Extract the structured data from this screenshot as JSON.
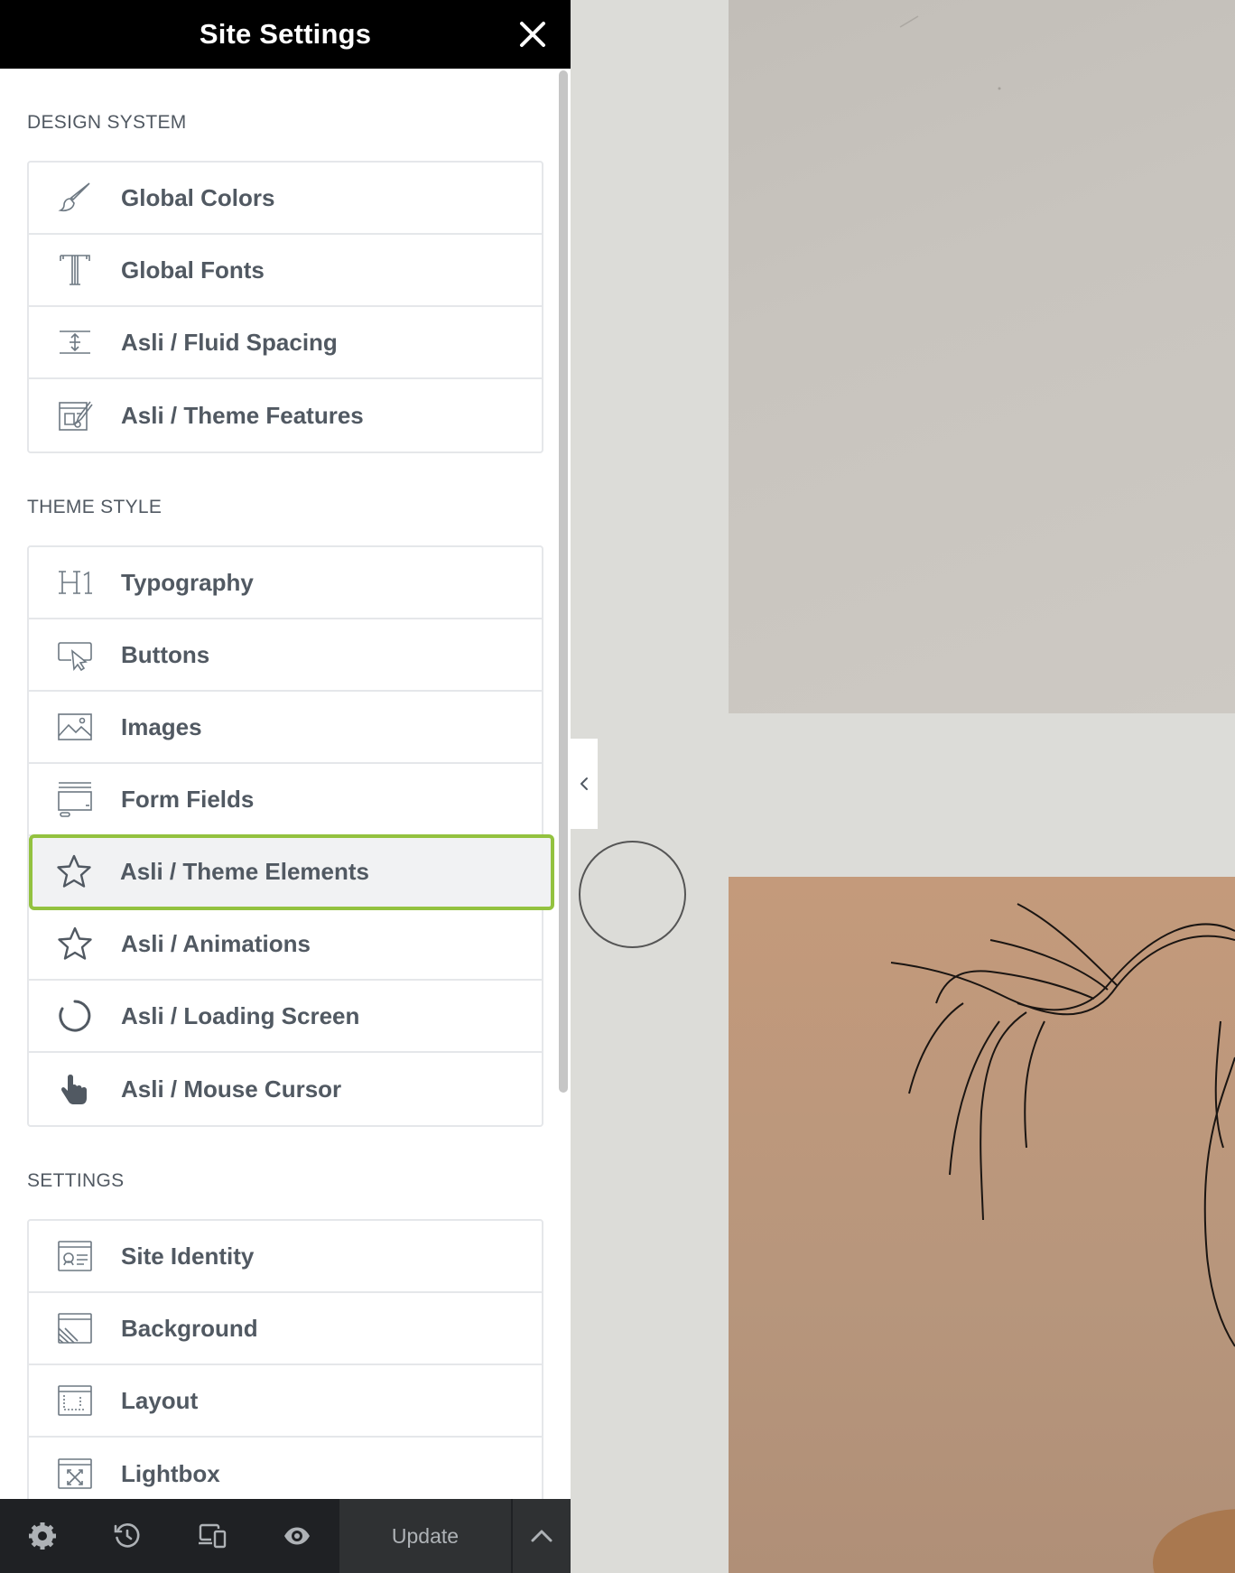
{
  "header": {
    "title": "Site Settings"
  },
  "sections": {
    "design_system": {
      "title": "DESIGN SYSTEM",
      "items": [
        {
          "label": "Global Colors",
          "icon": "paintbrush-icon"
        },
        {
          "label": "Global Fonts",
          "icon": "typeface-icon"
        },
        {
          "label": "Asli / Fluid Spacing",
          "icon": "spacing-icon"
        },
        {
          "label": "Asli / Theme Features",
          "icon": "theme-features-icon"
        }
      ]
    },
    "theme_style": {
      "title": "THEME STYLE",
      "items": [
        {
          "label": "Typography",
          "icon": "h1-icon"
        },
        {
          "label": "Buttons",
          "icon": "button-cursor-icon"
        },
        {
          "label": "Images",
          "icon": "image-icon"
        },
        {
          "label": "Form Fields",
          "icon": "form-fields-icon"
        },
        {
          "label": "Asli / Theme Elements",
          "icon": "star-icon",
          "active": true
        },
        {
          "label": "Asli / Animations",
          "icon": "star-icon"
        },
        {
          "label": "Asli / Loading Screen",
          "icon": "loading-icon"
        },
        {
          "label": "Asli / Mouse Cursor",
          "icon": "pointer-hand-icon"
        }
      ]
    },
    "settings": {
      "title": "SETTINGS",
      "items": [
        {
          "label": "Site Identity",
          "icon": "site-identity-icon"
        },
        {
          "label": "Background",
          "icon": "background-icon"
        },
        {
          "label": "Layout",
          "icon": "layout-icon"
        },
        {
          "label": "Lightbox",
          "icon": "lightbox-icon"
        }
      ]
    }
  },
  "footer": {
    "update_label": "Update",
    "icons": [
      "gear-icon",
      "history-icon",
      "responsive-icon",
      "eye-icon",
      "chevron-up-icon"
    ]
  },
  "colors": {
    "header_bg": "#000000",
    "active_outline": "#93c23f",
    "label_text": "#515962",
    "footer_bg": "#1f2124"
  }
}
